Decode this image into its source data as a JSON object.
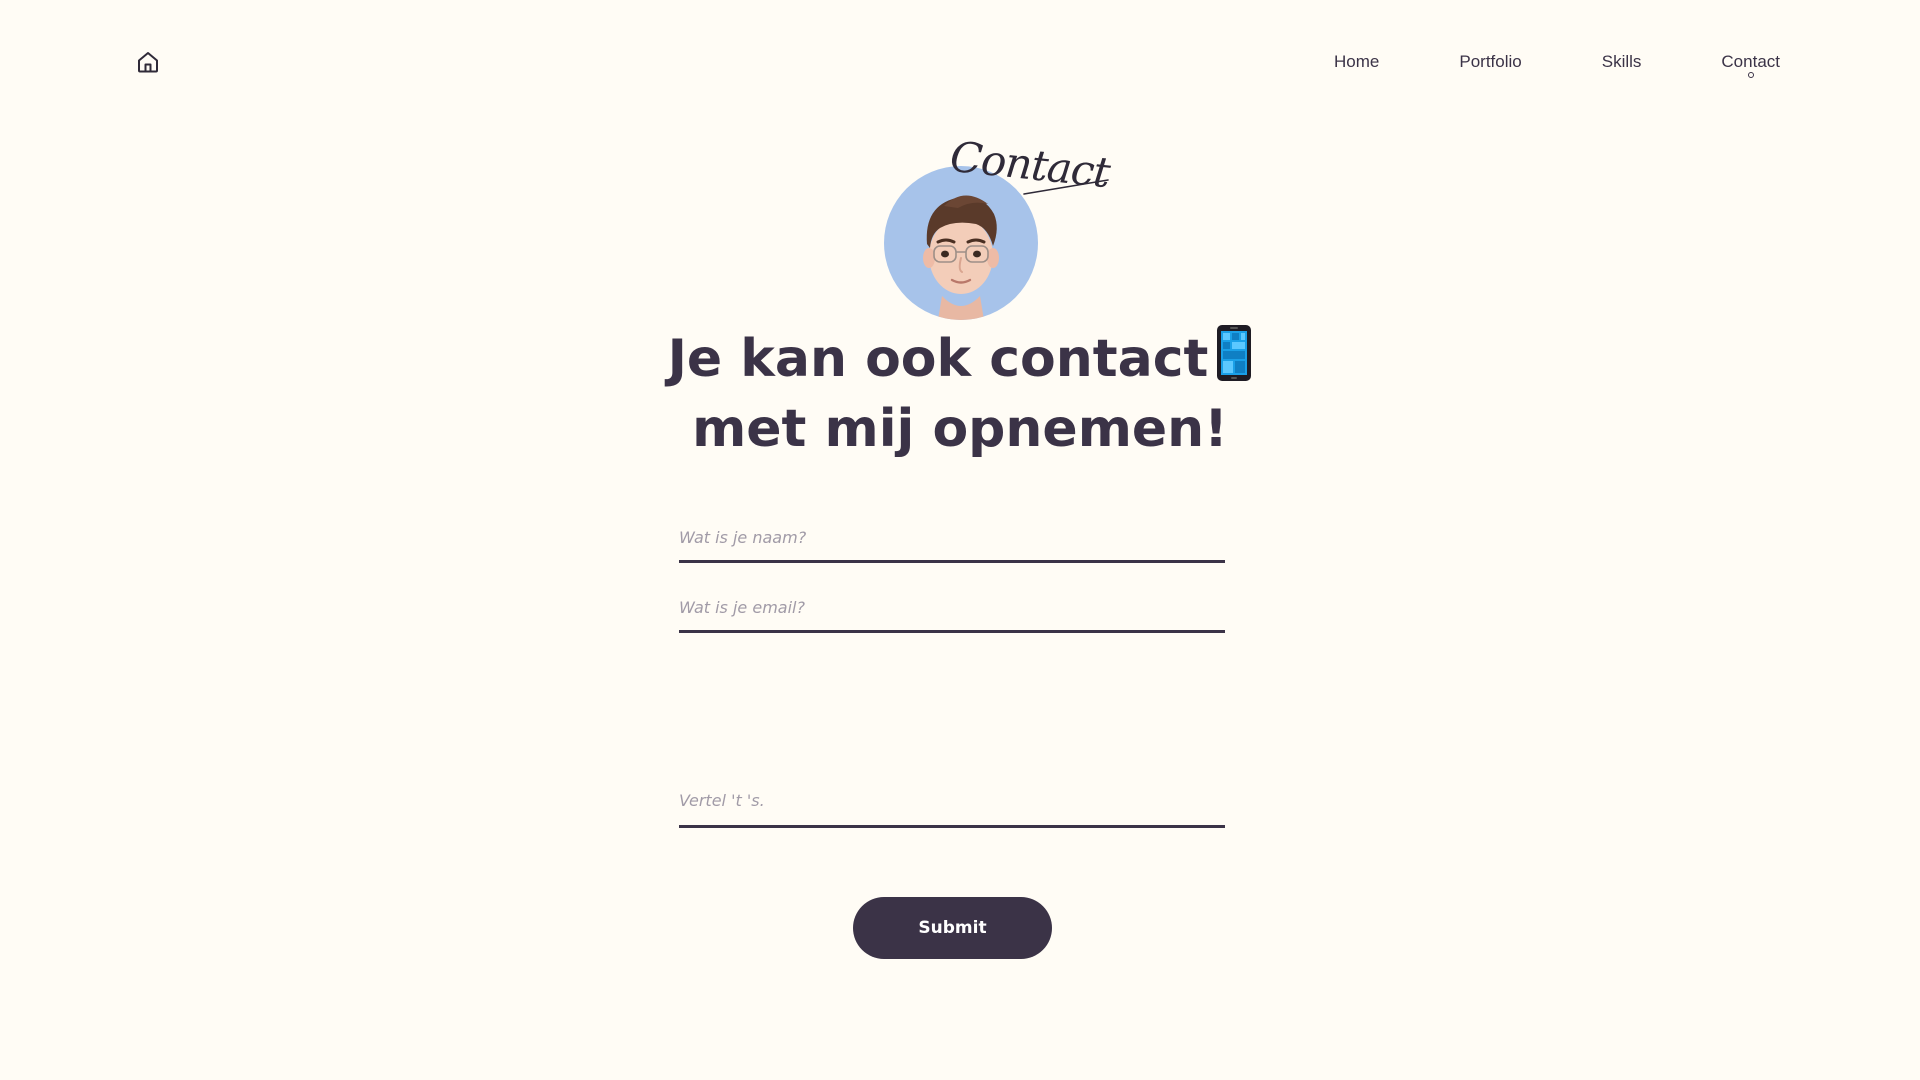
{
  "nav": {
    "home_icon": "home-icon",
    "links": [
      {
        "label": "Home"
      },
      {
        "label": "Portfolio"
      },
      {
        "label": "Skills"
      },
      {
        "label": "Contact",
        "active": true
      }
    ]
  },
  "hero": {
    "script_label": "Contact",
    "headline_line1": "Je kan ook contact",
    "headline_line2": "met mij opnemen!",
    "headline_icon": "mobile-phone-icon",
    "avatar": "memoji-avatar"
  },
  "form": {
    "name_placeholder": "Wat is je naam?",
    "email_placeholder": "Wat is je email?",
    "message_placeholder": "Vertel 't 's.",
    "submit_label": "Submit"
  },
  "colors": {
    "background": "#fffcf5",
    "text": "#3b3347",
    "accent": "#3b3347",
    "avatar_bg": "#a7c3ea",
    "placeholder": "#a19ba7"
  }
}
